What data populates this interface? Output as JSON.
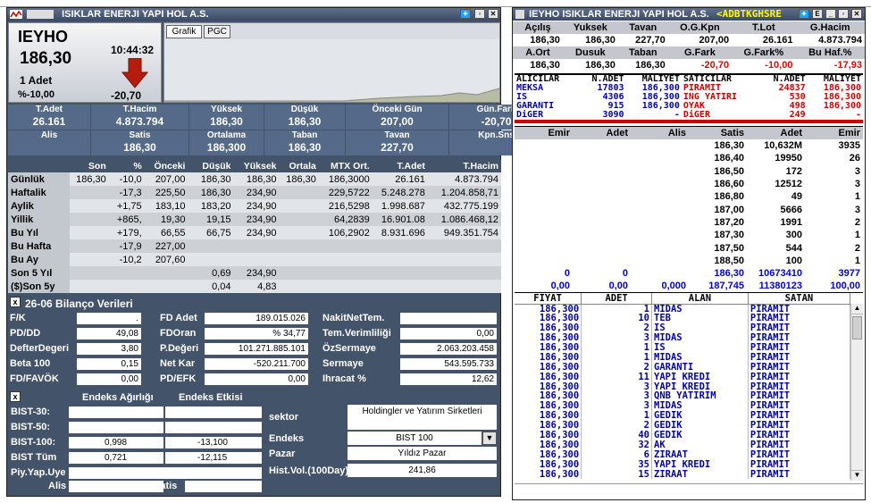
{
  "left": {
    "window_title": "ISIKLAR ENERJI YAPI HOL A.S.",
    "symbol": "IEYHO",
    "price": "186,30",
    "lot": "1 Adet",
    "pct": "%-10,00",
    "time": "10:44:32",
    "change": "-20,70",
    "tabs": [
      "Grafik",
      "PGC"
    ],
    "summary1_headers": [
      "T.Adet",
      "T.Hacim",
      "Yüksek",
      "Düşük",
      "Önceki Gün",
      "Gün.Fark"
    ],
    "summary1_values": [
      "26.161",
      "4.873.794",
      "186,30",
      "186,30",
      "207,00",
      "-20,70"
    ],
    "summary2_headers": [
      "Alis",
      "Satis",
      "Ortalama",
      "Taban",
      "Tavan",
      "Kpn.Sns"
    ],
    "summary2_values": [
      "",
      "186,30",
      "186,300",
      "186,30",
      "227,70",
      ""
    ],
    "period_headers": [
      "",
      "Son",
      "%",
      "Önceki",
      "Düşük",
      "Yüksek",
      "Ortala",
      "MTX Ort.",
      "T.Adet",
      "T.Hacim"
    ],
    "period_rows": [
      [
        "Günlük",
        "186,30",
        "-10,0",
        "207,00",
        "186,30",
        "186,30",
        "186,30",
        "186,3000",
        "26.161",
        "4.873.794"
      ],
      [
        "Haftalik",
        "",
        "-17,3",
        "225,50",
        "186,30",
        "234,90",
        "",
        "229,5722",
        "5.248.278",
        "1.204.858,71"
      ],
      [
        "Aylik",
        "",
        "+1,75",
        "183,10",
        "183,20",
        "234,90",
        "",
        "216,5298",
        "1.998.687",
        "432.775.199"
      ],
      [
        "Yillik",
        "",
        "+865,",
        "19,30",
        "19,15",
        "234,90",
        "",
        "64,2839",
        "16.901.08",
        "1.086.468,12"
      ],
      [
        "Bu Yıl",
        "",
        "+179,",
        "66,55",
        "66,75",
        "234,90",
        "",
        "106,2902",
        "8.931.696",
        "949.351.754"
      ],
      [
        "Bu Hafta",
        "",
        "-17,9",
        "227,00",
        "",
        "",
        "",
        "",
        "",
        ""
      ],
      [
        "Bu Ay",
        "",
        "-10,2",
        "207,60",
        "",
        "",
        "",
        "",
        "",
        ""
      ],
      [
        "Son 5 Yıl",
        "",
        "",
        "",
        "0,69",
        "234,90",
        "",
        "",
        "",
        ""
      ],
      [
        "($)Son 5y",
        "",
        "",
        "",
        "0,04",
        "4,83",
        "",
        "",
        "",
        ""
      ]
    ],
    "bilanco_title": "26-06 Bilanço Verileri",
    "bilanco": {
      "col1": [
        [
          "F/K",
          "."
        ],
        [
          "PD/DD",
          "49,08"
        ],
        [
          "DefterDegeri",
          "3,80"
        ],
        [
          "Beta 100",
          "0,15"
        ],
        [
          "FD/FAVÖK",
          "0,00"
        ]
      ],
      "col2": [
        [
          "FD Adet",
          "189.015.026"
        ],
        [
          "FDOran",
          "% 34,77"
        ],
        [
          "P.Değeri",
          "101.271.885.101"
        ],
        [
          "Net Kar",
          "-520.211.700"
        ],
        [
          "PD/EFK",
          "0,00"
        ]
      ],
      "col3": [
        [
          "NakitNetTem.",
          ""
        ],
        [
          "Tem.Verimliliği",
          "0,00"
        ],
        [
          "ÖzSermaye",
          "2.063.203.458"
        ],
        [
          "Sermaye",
          "543.595.733"
        ],
        [
          "Ihracat %",
          "12,62"
        ]
      ]
    },
    "endeks": {
      "h1": "Endeks Ağırlığı",
      "h2": "Endeks Etkisi",
      "rows": [
        [
          "BIST-30:",
          "",
          ""
        ],
        [
          "BIST-50:",
          "",
          ""
        ],
        [
          "BIST-100:",
          "0,998",
          "-13,100"
        ],
        [
          "BIST Tüm",
          "0,721",
          "-12,115"
        ],
        [
          "Piy.Yap.Uye",
          "",
          ""
        ]
      ],
      "alis": "Alis",
      "satis": "Satis",
      "sektor_label": "sektor",
      "sektor_value": "Holdingler ve Yatırım Sirketleri",
      "endeks_label": "Endeks",
      "endeks_value": "BIST 100",
      "pazar_label": "Pazar",
      "pazar_value": "Yıldız Pazar",
      "histvol_label": "Hist.Vol.(100Day)",
      "histvol_value": "241,86"
    }
  },
  "right": {
    "window_title": "IEYHO  ISIKLAR ENERJI YAPI HOL A.S.",
    "ticker": "<ADBTKGHSRE",
    "stats_h1": [
      "Açılış",
      "Yuksek",
      "Tavan",
      "O.G.Kpn",
      "T.Lot",
      "G.Hacim"
    ],
    "stats_v1": [
      "186,30",
      "186,30",
      "227,70",
      "207,00",
      "26.161",
      "4.873.794"
    ],
    "stats_h2": [
      "A.Ort",
      "Dusuk",
      "Taban",
      "G.Fark",
      "G.Fark%",
      "Bu Haf.%"
    ],
    "stats_v2": [
      "186,30",
      "186,30",
      "186,30",
      "-20,70",
      "-10,00",
      "-17,93"
    ],
    "broker_headers": [
      "ALICILAR",
      "N.ADET",
      "MALIYET",
      "SATICILAR",
      "N.ADET",
      "MALIYET"
    ],
    "brokers": [
      [
        "MEKSA",
        "17803",
        "186,300",
        "PIRAMIT",
        "24837",
        "186,300"
      ],
      [
        "IS",
        "4306",
        "186,300",
        "ING YATIRI",
        "530",
        "186,300"
      ],
      [
        "GARANTI",
        "915",
        "186,300",
        "OYAK",
        "498",
        "186,300"
      ],
      [
        "DiGER",
        "3090",
        "-",
        "DiGER",
        "249",
        "-"
      ]
    ],
    "depth_headers": [
      "Emir",
      "Adet",
      "Alis",
      "Satis",
      "Adet",
      "Emir"
    ],
    "depth_rows": [
      [
        "186,30",
        "10,632M",
        "3935"
      ],
      [
        "186,40",
        "19950",
        "26"
      ],
      [
        "186,50",
        "172",
        "3"
      ],
      [
        "186,60",
        "12512",
        "3"
      ],
      [
        "186,80",
        "49",
        "1"
      ],
      [
        "187,00",
        "5666",
        "3"
      ],
      [
        "187,20",
        "1991",
        "2"
      ],
      [
        "187,30",
        "300",
        "1"
      ],
      [
        "187,50",
        "544",
        "2"
      ],
      [
        "188,50",
        "100",
        "1"
      ]
    ],
    "depth_total1": [
      "0",
      "0",
      "",
      "186,30",
      "10673410",
      "3977"
    ],
    "depth_total2": [
      "0,00",
      "0,00",
      "0,000",
      "187,745",
      "11380123",
      "100,00"
    ],
    "trades_headers": [
      "FIYAT",
      "ADET",
      "ALAN",
      "SATAN"
    ],
    "trades": [
      [
        "186,300",
        "1",
        "MIDAS",
        "PIRAMIT"
      ],
      [
        "186,300",
        "10",
        "TEB",
        "PIRAMIT"
      ],
      [
        "186,300",
        "2",
        "IS",
        "PIRAMIT"
      ],
      [
        "186,300",
        "3",
        "MIDAS",
        "PIRAMIT"
      ],
      [
        "186,300",
        "1",
        "IS",
        "PIRAMIT"
      ],
      [
        "186,300",
        "1",
        "MIDAS",
        "PIRAMIT"
      ],
      [
        "186,300",
        "2",
        "GARANTI",
        "PIRAMIT"
      ],
      [
        "186,300",
        "11",
        "YAPI KREDI",
        "PIRAMIT"
      ],
      [
        "186,300",
        "3",
        "YAPI KREDI",
        "PIRAMIT"
      ],
      [
        "186,300",
        "3",
        "QNB YATIRIM",
        "PIRAMIT"
      ],
      [
        "186,300",
        "3",
        "MIDAS",
        "PIRAMIT"
      ],
      [
        "186,300",
        "1",
        "GEDIK",
        "PIRAMIT"
      ],
      [
        "186,300",
        "2",
        "GEDIK",
        "PIRAMIT"
      ],
      [
        "186,300",
        "40",
        "GEDIK",
        "PIRAMIT"
      ],
      [
        "186,300",
        "32",
        "AK",
        "PIRAMIT"
      ],
      [
        "186,300",
        "6",
        "ZIRAAT",
        "PIRAMIT"
      ],
      [
        "186,300",
        "35",
        "YAPI KREDI",
        "PIRAMIT"
      ],
      [
        "186,300",
        "15",
        "ZIRAAT",
        "PIRAMIT"
      ]
    ]
  }
}
